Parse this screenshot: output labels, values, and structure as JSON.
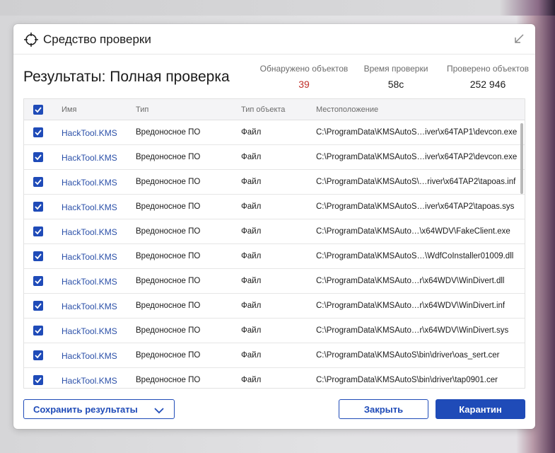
{
  "window": {
    "title": "Средство проверки"
  },
  "results": {
    "title": "Результаты: Полная проверка"
  },
  "stats": [
    {
      "label": "Обнаружено объектов",
      "value": "39"
    },
    {
      "label": "Время проверки",
      "value": "58с"
    },
    {
      "label": "Проверено объектов",
      "value": "252 946"
    }
  ],
  "table": {
    "headers": {
      "name": "Имя",
      "type": "Тип",
      "object_type": "Тип объекта",
      "location": "Местоположение"
    },
    "rows": [
      {
        "name": "HackTool.KMS",
        "type": "Вредоносное ПО",
        "object_type": "Файл",
        "location": "C:\\ProgramData\\KMSAutoS…iver\\x64TAP1\\devcon.exe",
        "checked": true
      },
      {
        "name": "HackTool.KMS",
        "type": "Вредоносное ПО",
        "object_type": "Файл",
        "location": "C:\\ProgramData\\KMSAutoS…iver\\x64TAP2\\devcon.exe",
        "checked": true
      },
      {
        "name": "HackTool.KMS",
        "type": "Вредоносное ПО",
        "object_type": "Файл",
        "location": "C:\\ProgramData\\KMSAutoS\\…river\\x64TAP2\\tapoas.inf",
        "checked": true
      },
      {
        "name": "HackTool.KMS",
        "type": "Вредоносное ПО",
        "object_type": "Файл",
        "location": "C:\\ProgramData\\KMSAutoS…iver\\x64TAP2\\tapoas.sys",
        "checked": true
      },
      {
        "name": "HackTool.KMS",
        "type": "Вредоносное ПО",
        "object_type": "Файл",
        "location": "C:\\ProgramData\\KMSAuto…\\x64WDV\\FakeClient.exe",
        "checked": true
      },
      {
        "name": "HackTool.KMS",
        "type": "Вредоносное ПО",
        "object_type": "Файл",
        "location": "C:\\ProgramData\\KMSAutoS…\\WdfCoInstaller01009.dll",
        "checked": true
      },
      {
        "name": "HackTool.KMS",
        "type": "Вредоносное ПО",
        "object_type": "Файл",
        "location": "C:\\ProgramData\\KMSAuto…r\\x64WDV\\WinDivert.dll",
        "checked": true
      },
      {
        "name": "HackTool.KMS",
        "type": "Вредоносное ПО",
        "object_type": "Файл",
        "location": "C:\\ProgramData\\KMSAuto…r\\x64WDV\\WinDivert.inf",
        "checked": true
      },
      {
        "name": "HackTool.KMS",
        "type": "Вредоносное ПО",
        "object_type": "Файл",
        "location": "C:\\ProgramData\\KMSAuto…r\\x64WDV\\WinDivert.sys",
        "checked": true
      },
      {
        "name": "HackTool.KMS",
        "type": "Вредоносное ПО",
        "object_type": "Файл",
        "location": "C:\\ProgramData\\KMSAutoS\\bin\\driver\\oas_sert.cer",
        "checked": true
      },
      {
        "name": "HackTool.KMS",
        "type": "Вредоносное ПО",
        "object_type": "Файл",
        "location": "C:\\ProgramData\\KMSAutoS\\bin\\driver\\tap0901.cer",
        "checked": true
      }
    ]
  },
  "buttons": {
    "save": "Сохранить результаты",
    "close": "Закрыть",
    "quarantine": "Карантин"
  },
  "colors": {
    "accent": "#1f4bb8",
    "link": "#2a4fa8",
    "alert": "#c0302a"
  }
}
